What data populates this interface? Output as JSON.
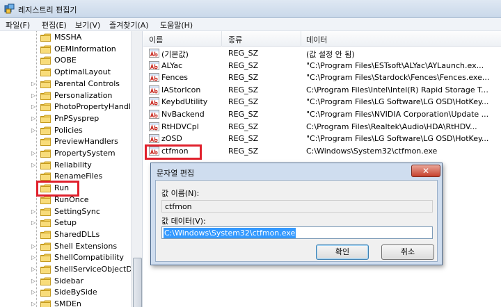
{
  "window": {
    "title": "레지스트리 편집기"
  },
  "menu": [
    {
      "label": "파일(F)"
    },
    {
      "label": "편집(E)"
    },
    {
      "label": "보기(V)"
    },
    {
      "label": "즐겨찾기(A)"
    },
    {
      "label": "도움말(H)"
    }
  ],
  "tree": {
    "items": [
      {
        "label": "MSSHA",
        "expander": ""
      },
      {
        "label": "OEMInformation",
        "expander": ""
      },
      {
        "label": "OOBE",
        "expander": ""
      },
      {
        "label": "OptimalLayout",
        "expander": ""
      },
      {
        "label": "Parental Controls",
        "expander": "▷"
      },
      {
        "label": "Personalization",
        "expander": "▷"
      },
      {
        "label": "PhotoPropertyHandler",
        "expander": "▷"
      },
      {
        "label": "PnPSysprep",
        "expander": "▷"
      },
      {
        "label": "Policies",
        "expander": "▷"
      },
      {
        "label": "PreviewHandlers",
        "expander": ""
      },
      {
        "label": "PropertySystem",
        "expander": "▷"
      },
      {
        "label": "Reliability",
        "expander": "▷"
      },
      {
        "label": "RenameFiles",
        "expander": ""
      },
      {
        "label": "Run",
        "expander": ""
      },
      {
        "label": "RunOnce",
        "expander": ""
      },
      {
        "label": "SettingSync",
        "expander": "▷"
      },
      {
        "label": "Setup",
        "expander": "▷"
      },
      {
        "label": "SharedDLLs",
        "expander": ""
      },
      {
        "label": "Shell Extensions",
        "expander": "▷"
      },
      {
        "label": "ShellCompatibility",
        "expander": "▷"
      },
      {
        "label": "ShellServiceObjectDel",
        "expander": "▷"
      },
      {
        "label": "Sidebar",
        "expander": "▷"
      },
      {
        "label": "SideBySide",
        "expander": "▷"
      },
      {
        "label": "SMDEn",
        "expander": "▷"
      }
    ]
  },
  "list": {
    "columns": {
      "name": "이름",
      "type": "종류",
      "data": "데이터"
    },
    "rows": [
      {
        "name": "(기본값)",
        "type": "REG_SZ",
        "data": "(값 설정 안 됨)"
      },
      {
        "name": "ALYac",
        "type": "REG_SZ",
        "data": "\"C:\\Program Files\\ESTsoft\\ALYac\\AYLaunch.ex..."
      },
      {
        "name": "Fences",
        "type": "REG_SZ",
        "data": "\"C:\\Program Files\\Stardock\\Fences\\Fences.exe..."
      },
      {
        "name": "IAStorIcon",
        "type": "REG_SZ",
        "data": "C:\\Program Files\\Intel\\Intel(R) Rapid Storage Te..."
      },
      {
        "name": "KeybdUtility",
        "type": "REG_SZ",
        "data": "\"C:\\Program Files\\LG Software\\LG OSD\\HotKey..."
      },
      {
        "name": "NvBackend",
        "type": "REG_SZ",
        "data": "\"C:\\Program Files\\NVIDIA Corporation\\Update ..."
      },
      {
        "name": "RtHDVCpl",
        "type": "REG_SZ",
        "data": "C:\\Program Files\\Realtek\\Audio\\HDA\\RtHDV..."
      },
      {
        "name": "zOSD",
        "type": "REG_SZ",
        "data": "\"C:\\Program Files\\LG Software\\LG OSD\\HotKey..."
      },
      {
        "name": "ctfmon",
        "type": "REG_SZ",
        "data": "C:\\Windows\\System32\\ctfmon.exe"
      }
    ]
  },
  "dialog": {
    "title": "문자열 편집",
    "close": "✕",
    "name_label": "값 이름(N):",
    "name_value": "ctfmon",
    "data_label": "값 데이터(V):",
    "data_value": "C:\\Windows\\System32\\ctfmon.exe",
    "ok": "확인",
    "cancel": "취소"
  },
  "colors": {
    "highlight": "#e0202c",
    "selection": "#3399ff"
  }
}
